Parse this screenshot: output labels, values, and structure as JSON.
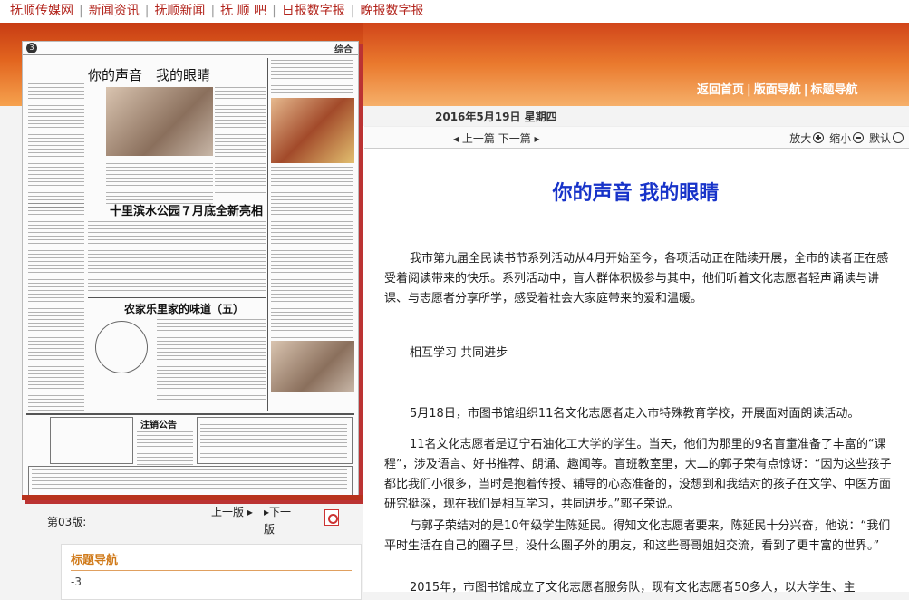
{
  "topnav": {
    "items": [
      "抚顺传媒网",
      "新闻资讯",
      "抚顺新闻",
      "抚 顺 吧",
      "日报数字报",
      "晚报数字报"
    ]
  },
  "header_nav": {
    "items": [
      "返回首页",
      "版面导航",
      "标题导航"
    ]
  },
  "date": "2016年5月19日 星期四",
  "paper": {
    "page_num": "3",
    "section": "综合",
    "headline_main": "你的声音　我的眼睛",
    "headline_second": "十里滨水公园７月底全新亮相",
    "headline_third": "农家乐里家的味道（五）",
    "side_head": "注销公告"
  },
  "pager": {
    "page_label": "第03版:",
    "prev_label": "上一版",
    "next_label": "下一版"
  },
  "title_nav": {
    "heading": "标题导航",
    "first_item": "-3"
  },
  "toolbar": {
    "prev": "上一篇",
    "next": "下一篇",
    "zoom_in": "放大",
    "zoom_out": "缩小",
    "default": "默认"
  },
  "article": {
    "title": "你的声音  我的眼睛",
    "paragraphs": [
      "我市第九届全民读书节系列活动从4月开始至今，各项活动正在陆续开展，全市的读者正在感受着阅读带来的快乐。系列活动中，盲人群体积极参与其中，他们听着文化志愿者轻声诵读与讲课、与志愿者分享所学，感受着社会大家庭带来的爱和温暖。",
      "相互学习 共同进步",
      "5月18日，市图书馆组织11名文化志愿者走入市特殊教育学校，开展面对面朗读活动。",
      "11名文化志愿者是辽宁石油化工大学的学生。当天，他们为那里的9名盲童准备了丰富的“课程”，涉及语言、好书推荐、朗诵、趣闻等。盲班教室里，大二的郭子荣有点惊讶：“因为这些孩子都比我们小很多，当时是抱着传授、辅导的心态准备的，没想到和我结对的孩子在文学、中医方面研究挺深，现在我们是相互学习，共同进步。”郭子荣说。",
      "与郭子荣结对的是10年级学生陈延民。得知文化志愿者要来，陈延民十分兴奋，他说：“我们平时生活在自己的圈子里，没什么圈子外的朋友，和这些哥哥姐姐交流，看到了更丰富的世界。”",
      "2015年，市图书馆成立了文化志愿者服务队，现有文化志愿者50多人，以大学生、主"
    ]
  }
}
